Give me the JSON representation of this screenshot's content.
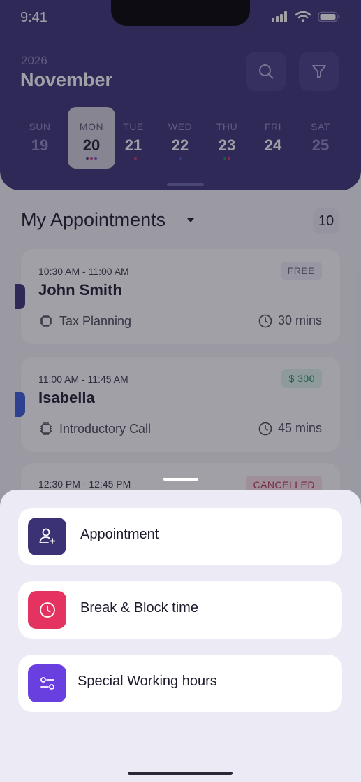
{
  "status": {
    "time": "9:41"
  },
  "header": {
    "year": "2026",
    "month": "November",
    "days": [
      {
        "name": "SUN",
        "date": "19",
        "state": "inactive",
        "dots": []
      },
      {
        "name": "MON",
        "date": "20",
        "state": "selected",
        "dots": [
          "#3a3275",
          "#e0335e",
          "#7a4be2"
        ]
      },
      {
        "name": "TUE",
        "date": "21",
        "state": "active",
        "dots": [
          "#3a3275",
          "#e0335e"
        ]
      },
      {
        "name": "WED",
        "date": "22",
        "state": "active",
        "dots": [
          "#3b5bd9"
        ]
      },
      {
        "name": "THU",
        "date": "23",
        "state": "active",
        "dots": [
          "#1e8a55",
          "#e0335e"
        ]
      },
      {
        "name": "FRI",
        "date": "24",
        "state": "active",
        "dots": []
      },
      {
        "name": "SAT",
        "date": "25",
        "state": "inactive",
        "dots": []
      }
    ]
  },
  "appointments": {
    "title": "My Appointments",
    "count": "10",
    "items": [
      {
        "time": "10:30 AM - 11:00 AM",
        "name": "John Smith",
        "service": "Tax Planning",
        "duration": "30 mins",
        "badge": "FREE",
        "badge_type": "free",
        "edge_color": "#3a3275"
      },
      {
        "time": "11:00 AM - 11:45 AM",
        "name": "Isabella",
        "service": "Introductory Call",
        "duration": "45 mins",
        "badge": "$ 300",
        "badge_type": "price",
        "edge_color": "#3b5bd9"
      },
      {
        "time": "12:30 PM - 12:45 PM",
        "name": "",
        "service": "",
        "duration": "",
        "badge": "CANCELLED",
        "badge_type": "cancel",
        "edge_color": ""
      }
    ]
  },
  "sheet": {
    "options": [
      {
        "label": "Appointment",
        "icon": "user-plus-icon",
        "color": "#3a3275"
      },
      {
        "label": "Break & Block time",
        "icon": "clock-icon",
        "color": "#e53361"
      },
      {
        "label": "Special Working hours",
        "icon": "sliders-icon",
        "color": "#6a3fe0"
      }
    ]
  }
}
